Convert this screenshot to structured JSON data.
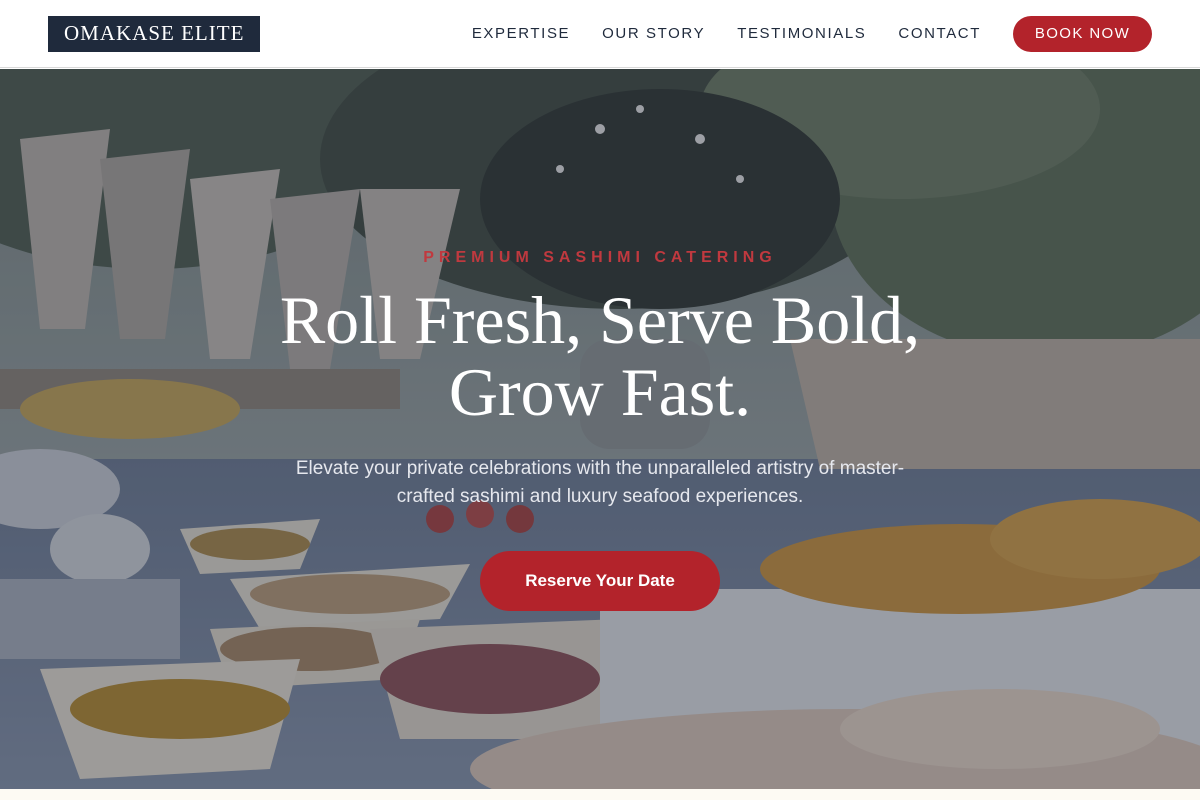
{
  "header": {
    "logo": "OMAKASE ELITE",
    "nav": [
      {
        "label": "EXPERTISE"
      },
      {
        "label": "OUR STORY"
      },
      {
        "label": "TESTIMONIALS"
      },
      {
        "label": "CONTACT"
      }
    ],
    "book_label": "BOOK NOW"
  },
  "hero": {
    "eyebrow": "PREMIUM SASHIMI CATERING",
    "headline_line1": "Roll Fresh, Serve Bold,",
    "headline_line2": "Grow Fast.",
    "subtext": "Elevate your private celebrations with the unparalleled artistry of master-crafted sashimi and luxury seafood experiences.",
    "cta_label": "Reserve Your Date"
  },
  "colors": {
    "navy": "#1f2a3c",
    "accent_red": "#b3232b",
    "eyebrow_red": "#c0393f",
    "white": "#ffffff"
  }
}
